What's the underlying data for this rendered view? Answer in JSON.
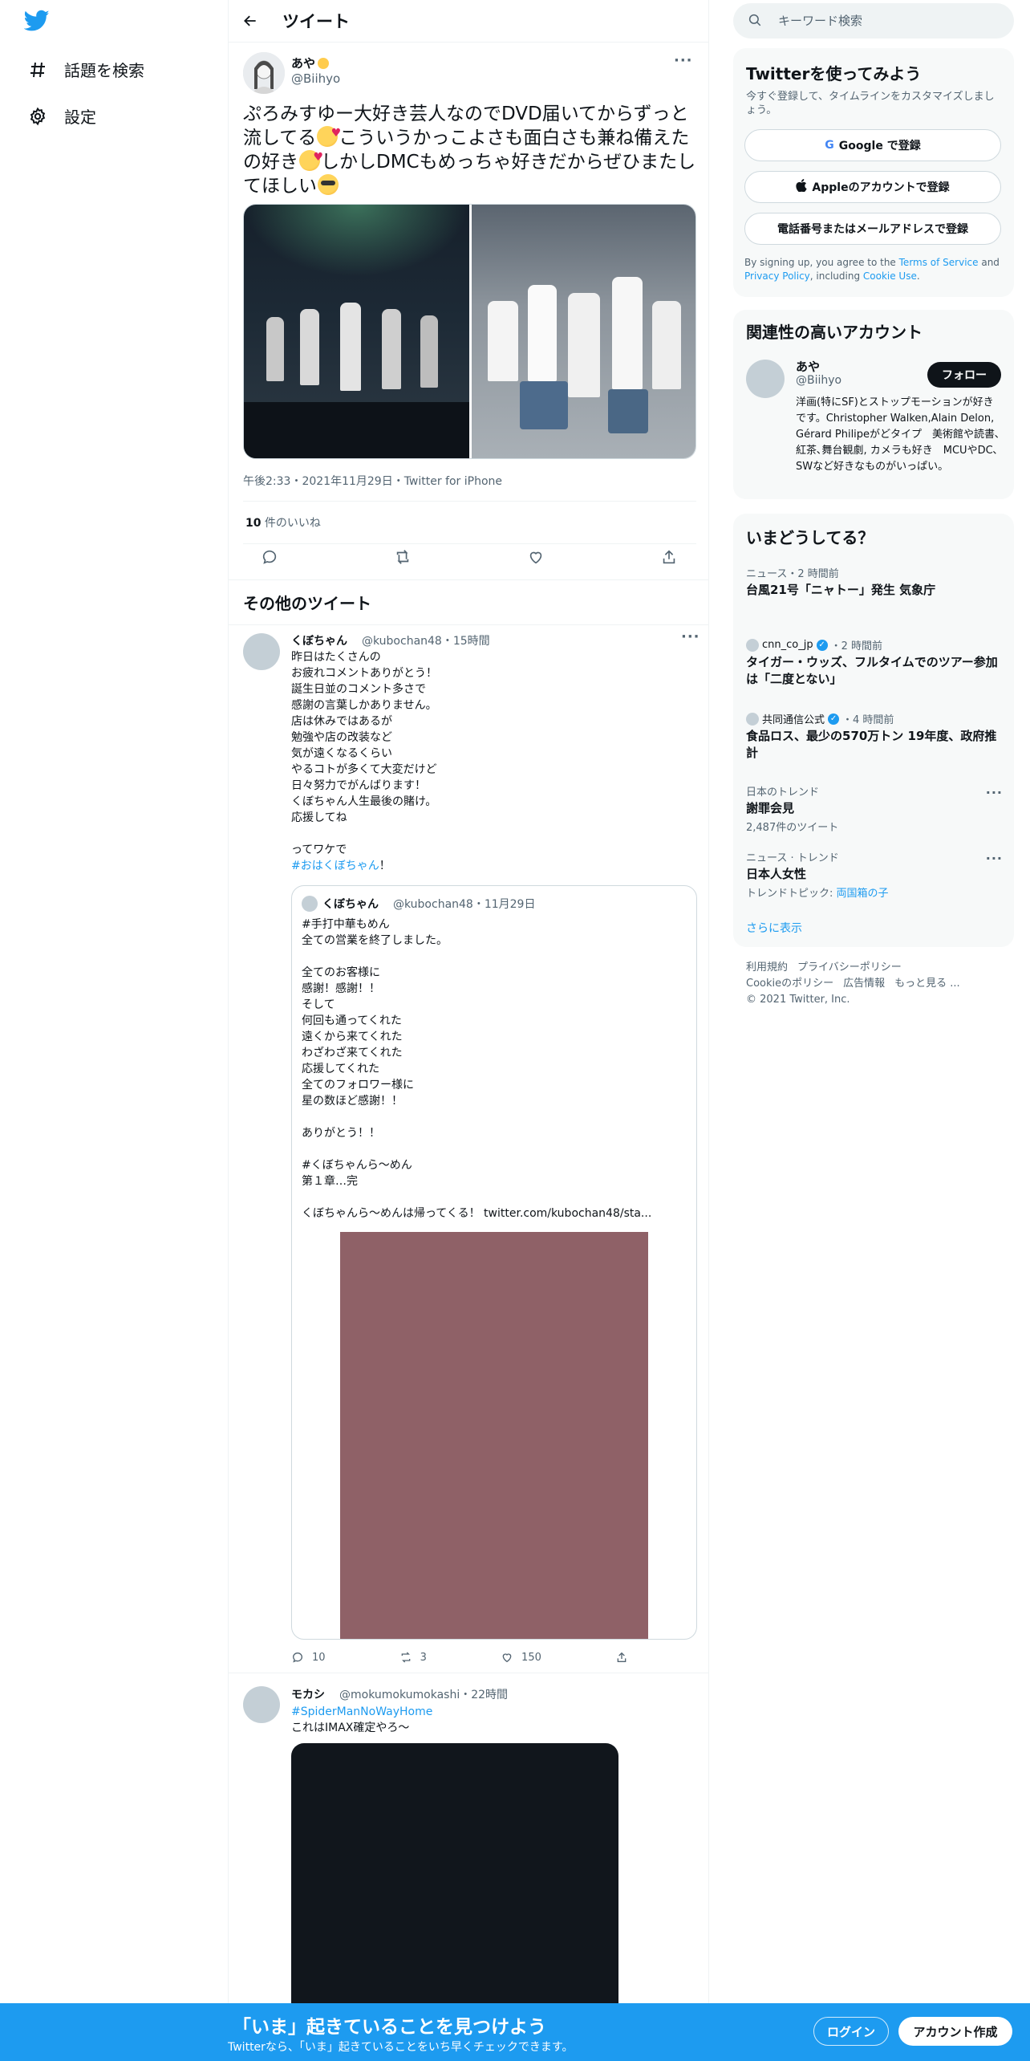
{
  "nav": {
    "explore_label": "話題を検索",
    "settings_label": "設定"
  },
  "header": {
    "title": "ツイート"
  },
  "focal_tweet": {
    "author_name": "あや",
    "author_handle": "@Biihyo",
    "text_parts": [
      "ぷろみすゆー大好き芸人なのでDVD届いてからずっと流してる",
      "こういうかっこよさも面白さも兼ね備えたの好き",
      "しかしDMCもめっちゃ好きだからぜひまたしてほしい"
    ],
    "timestamp": "午後2:33・2021年11月29日・Twitter for iPhone",
    "likes_count": "10",
    "likes_label": " 件のいいね"
  },
  "more_tweets": {
    "heading": "その他のツイート",
    "tweets": [
      {
        "name": "くぼちゃん",
        "handle": "@kubochan48・15時間",
        "text": "昨日はたくさんの\nお疲れコメントありがとう！\n誕生日並のコメント多さで\n感謝の言葉しかありません。\n店は休みではあるが\n勉強や店の改装など\n気が遠くなるくらい\nやるコトが多くて大変だけど\n日々努力でがんばります！\nくぼちゃん人生最後の賭け。\n応援してね\n\nってワケで",
        "hashtag": "#おはくぼちゃん",
        "hashtag_suffix": "！",
        "quote": {
          "name": "くぼちゃん",
          "handle": "@kubochan48・11月29日",
          "text": "#手打中華もめん\n全ての営業を終了しました。\n\n全てのお客様に\n感謝！感謝！！\nそして\n何回も通ってくれた\n遠くから来てくれた\nわざわざ来てくれた\n応援してくれた\n全てのフォロワー様に\n星の数ほど感謝！！\n\nありがとう！！\n\n#くぼちゃんら～めん\n第１章…完\n\nくぼちゃんら～めんは帰ってくる！ twitter.com/kubochan48/sta..."
        },
        "replies": "10",
        "retweets": "3",
        "likes": "150"
      },
      {
        "name": "モカシ",
        "handle": "@mokumokumokashi・22時間",
        "hashtag": "#SpiderManNoWayHome",
        "text": "これはIMAX確定やろ〜"
      }
    ]
  },
  "search": {
    "placeholder": "キーワード検索"
  },
  "signup_card": {
    "title": "Twitterを使ってみよう",
    "subtitle": "今すぐ登録して、タイムラインをカスタマイズしましょう。",
    "google_label": "Google で登録",
    "apple_label": "Appleのアカウントで登録",
    "phone_label": "電話番号またはメールアドレスで登録",
    "terms_prefix": "By signing up, you agree to the ",
    "terms_link": "Terms of Service",
    "terms_and": " and ",
    "privacy_link": "Privacy Policy",
    "terms_including": ", including ",
    "cookie_link": "Cookie Use",
    "terms_end": "."
  },
  "related_card": {
    "title": "関連性の高いアカウント",
    "name": "あや",
    "handle": "@Biihyo",
    "follow_label": "フォロー",
    "bio": "洋画(特にSF)とストップモーションが好きです。Christopher Walken,Alain Delon, Gérard Philipeがどタイプ　美術館や読書､紅茶､舞台観劇, カメラも好き　MCUやDC､SWなど好きなものがいっぱい。"
  },
  "trends_card": {
    "title": "いまどうしてる？",
    "items": [
      {
        "context": "ニュース・2 時間前",
        "title": "台風21号「ニャトー」発生 気象庁"
      },
      {
        "source": "cnn_co_jp",
        "context": "・2 時間前",
        "title": "タイガー・ウッズ、フルタイムでのツアー参加は「二度とない」"
      },
      {
        "source": "共同通信公式",
        "context": "・4 時間前",
        "title": "食品ロス、最少の570万トン 19年度、政府推計"
      },
      {
        "context": "日本のトレンド",
        "title": "謝罪会見",
        "sub": "2,487件のツイート"
      },
      {
        "context": "ニュース · トレンド",
        "title": "日本人女性",
        "sub_prefix": "トレンドトピック: ",
        "sub_link": "両国箱の子"
      }
    ],
    "show_more": "さらに表示"
  },
  "footer": {
    "terms": "利用規約",
    "privacy": "プライバシーポリシー",
    "cookie": "Cookieのポリシー",
    "ads": "広告情報",
    "more": "もっと見る ...",
    "copyright": "© 2021 Twitter, Inc."
  },
  "bottom_bar": {
    "headline": "「いま」起きていることを見つけよう",
    "subtext": "Twitterなら、「いま」起きていることをいち早くチェックできます。",
    "login_label": "ログイン",
    "signup_label": "アカウント作成"
  },
  "colors": {
    "accent": "#1d9bf0",
    "text": "#0f1419",
    "secondary": "#536471",
    "quote_media": "#8f6167"
  }
}
